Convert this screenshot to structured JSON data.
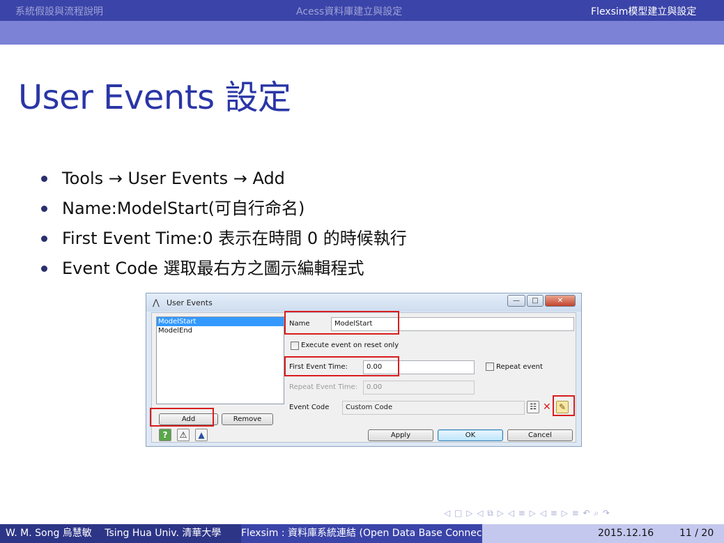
{
  "header": {
    "sections": [
      "系統假設與流程說明",
      "Acess資料庫建立與設定",
      "Flexsim模型建立與設定"
    ]
  },
  "slide": {
    "title": "User Events 設定",
    "bullets": [
      "Tools → User Events → Add",
      "Name:ModelStart(可自行命名)",
      "First Event Time:0 表示在時間 0 的時候執行",
      "Event Code 選取最右方之圖示編輯程式"
    ]
  },
  "dialog": {
    "title": "User Events",
    "window_buttons": {
      "minimize": "—",
      "maximize": "□",
      "close": "✕"
    },
    "events_list": [
      "ModelStart",
      "ModelEnd"
    ],
    "selected_event": "ModelStart",
    "add_label": "Add",
    "remove_label": "Remove",
    "name_label": "Name",
    "name_value": "ModelStart",
    "execute_on_reset_label": "Execute event on reset only",
    "execute_on_reset_checked": false,
    "first_event_time_label": "First Event Time:",
    "first_event_time_value": "0.00",
    "repeat_event_label": "Repeat event",
    "repeat_event_checked": false,
    "repeat_event_time_label": "Repeat Event Time:",
    "repeat_event_time_value": "0.00",
    "event_code_label": "Event Code",
    "event_code_value": "Custom Code",
    "apply_label": "Apply",
    "ok_label": "OK",
    "cancel_label": "Cancel",
    "icons": [
      "help-icon",
      "triggers-icon",
      "templates-icon",
      "code-properties-icon",
      "delete-x-icon",
      "edit-code-scroll-icon"
    ]
  },
  "nav_symbols": "◁ □ ▷ ◁ ⧉ ▷ ◁ ≡ ▷ ◁ ≡ ▷   ≡   ↶ ⌕ ↷",
  "footer": {
    "author": "W. M. Song 烏慧敏",
    "institute": "Tsing Hua Univ. 清華大學",
    "talk_title": "Flexsim : 資料庫系統連結 (Open Data Base Connectivity)",
    "date": "2015.12.16",
    "page": "11 / 20"
  },
  "colors": {
    "header": "#3b44a8",
    "header_band": "#7c83d6",
    "title": "#2a36a6",
    "highlight_box": "#d81d1d",
    "footer_dark": "#2d3587",
    "footer_light": "#c5c8ee"
  }
}
